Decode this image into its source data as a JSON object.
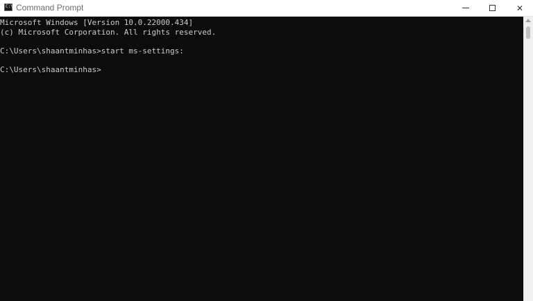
{
  "window": {
    "title": "Command Prompt",
    "icon": "cmd-icon",
    "icon_glyph": "C:\\",
    "controls": {
      "minimize": "minimize-icon",
      "maximize": "maximize-icon",
      "close": "close-icon",
      "close_glyph": "✕"
    }
  },
  "console": {
    "lines": [
      "Microsoft Windows [Version 10.0.22000.434]",
      "(c) Microsoft Corporation. All rights reserved.",
      "",
      "C:\\Users\\shaantminhas>start ms-settings:",
      "",
      "C:\\Users\\shaantminhas>"
    ],
    "text_color": "#cccccc",
    "background": "#0c0c0c"
  }
}
